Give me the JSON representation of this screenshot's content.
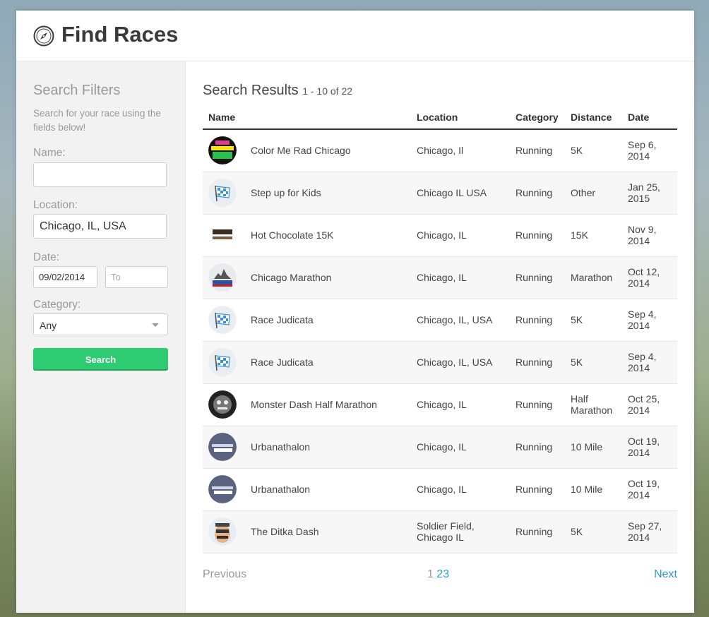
{
  "header": {
    "title": "Find Races"
  },
  "sidebar": {
    "title": "Search Filters",
    "help": "Search for your race using the fields below!",
    "name_label": "Name:",
    "name_value": "",
    "location_label": "Location:",
    "location_value": "Chicago, IL, USA",
    "date_label": "Date:",
    "date_from": "09/02/2014",
    "date_to_placeholder": "To",
    "category_label": "Category:",
    "category_value": "Any",
    "search_label": "Search"
  },
  "results": {
    "title": "Search Results",
    "range": "1 - 10 of 22",
    "columns": [
      "Name",
      "Location",
      "Category",
      "Distance",
      "Date"
    ],
    "rows": [
      {
        "name": "Color Me Rad Chicago",
        "location": "Chicago, Il",
        "category": "Running",
        "distance": "5K",
        "date": "Sep 6, 2014",
        "logo": "color-me-rad-logo"
      },
      {
        "name": "Step up for Kids",
        "location": "Chicago IL USA",
        "category": "Running",
        "distance": "Other",
        "date": "Jan 25, 2015",
        "logo": "checkered-flag-logo"
      },
      {
        "name": "Hot Chocolate 15K",
        "location": "Chicago, IL",
        "category": "Running",
        "distance": "15K",
        "date": "Nov 9, 2014",
        "logo": "hot-chocolate-logo"
      },
      {
        "name": "Chicago Marathon",
        "location": "Chicago, IL",
        "category": "Running",
        "distance": "Marathon",
        "date": "Oct 12, 2014",
        "logo": "chicago-marathon-logo"
      },
      {
        "name": "Race Judicata",
        "location": "Chicago, IL, USA",
        "category": "Running",
        "distance": "5K",
        "date": "Sep 4, 2014",
        "logo": "checkered-flag-logo"
      },
      {
        "name": "Race Judicata",
        "location": "Chicago, IL, USA",
        "category": "Running",
        "distance": "5K",
        "date": "Sep 4, 2014",
        "logo": "checkered-flag-logo"
      },
      {
        "name": "Monster Dash Half Marathon",
        "location": "Chicago, IL",
        "category": "Running",
        "distance": "Half Marathon",
        "date": "Oct 25, 2014",
        "logo": "monster-dash-logo"
      },
      {
        "name": "Urbanathalon",
        "location": "Chicago, IL",
        "category": "Running",
        "distance": "10 Mile",
        "date": "Oct 19, 2014",
        "logo": "urbanathalon-logo"
      },
      {
        "name": "Urbanathalon",
        "location": "Chicago, IL",
        "category": "Running",
        "distance": "10 Mile",
        "date": "Oct 19, 2014",
        "logo": "urbanathalon-logo"
      },
      {
        "name": "The Ditka Dash",
        "location": "Soldier Field, Chicago IL",
        "category": "Running",
        "distance": "5K",
        "date": "Sep 27, 2014",
        "logo": "ditka-dash-logo"
      }
    ]
  },
  "pagination": {
    "prev": "Previous",
    "current": "1",
    "pages": [
      "2",
      "3"
    ],
    "next": "Next"
  },
  "colors": {
    "accent": "#2ecc71",
    "link": "#2a9bd3"
  }
}
